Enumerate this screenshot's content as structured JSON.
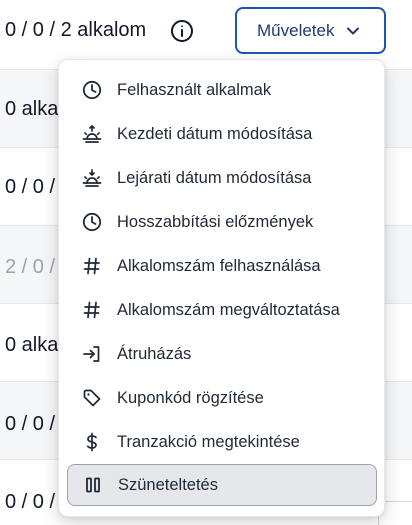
{
  "header": {
    "count_text": "0 / 0 / 2 alkalom",
    "actions_label": "Műveletek",
    "info_icon": "info-circle-icon",
    "chevron_icon": "chevron-down-icon"
  },
  "rows": [
    {
      "text": "0 alka",
      "shaded": true,
      "muted": false
    },
    {
      "text": "0 / 0 /",
      "shaded": false,
      "muted": false
    },
    {
      "text": "2 / 0 /",
      "shaded": true,
      "muted": true
    },
    {
      "text": "0 alka",
      "shaded": false,
      "muted": false
    },
    {
      "text": "0 / 0 /",
      "shaded": true,
      "muted": false
    },
    {
      "text": "0 / 0 /",
      "shaded": false,
      "muted": false
    }
  ],
  "menu": {
    "items": [
      {
        "label": "Felhasznált alkalmak",
        "icon": "clock-icon"
      },
      {
        "label": "Kezdeti dátum módosítása",
        "icon": "sunrise-icon"
      },
      {
        "label": "Lejárati dátum módosítása",
        "icon": "sunset-icon"
      },
      {
        "label": "Hosszabbítási előzmények",
        "icon": "clock-icon"
      },
      {
        "label": "Alkalomszám felhasználása",
        "icon": "hash-icon"
      },
      {
        "label": "Alkalomszám megváltoztatása",
        "icon": "hash-icon"
      },
      {
        "label": "Átruházás",
        "icon": "transfer-in-icon"
      },
      {
        "label": "Kuponkód rögzítése",
        "icon": "tag-icon"
      },
      {
        "label": "Tranzakció megtekintése",
        "icon": "dollar-icon"
      },
      {
        "label": "Szüneteltetés",
        "icon": "pause-icon"
      }
    ],
    "hovered_index": 9
  },
  "colors": {
    "accent": "#1e55b3",
    "text": "#1f2937",
    "muted": "#9ca3af",
    "row_shade": "#f5f6f8"
  }
}
